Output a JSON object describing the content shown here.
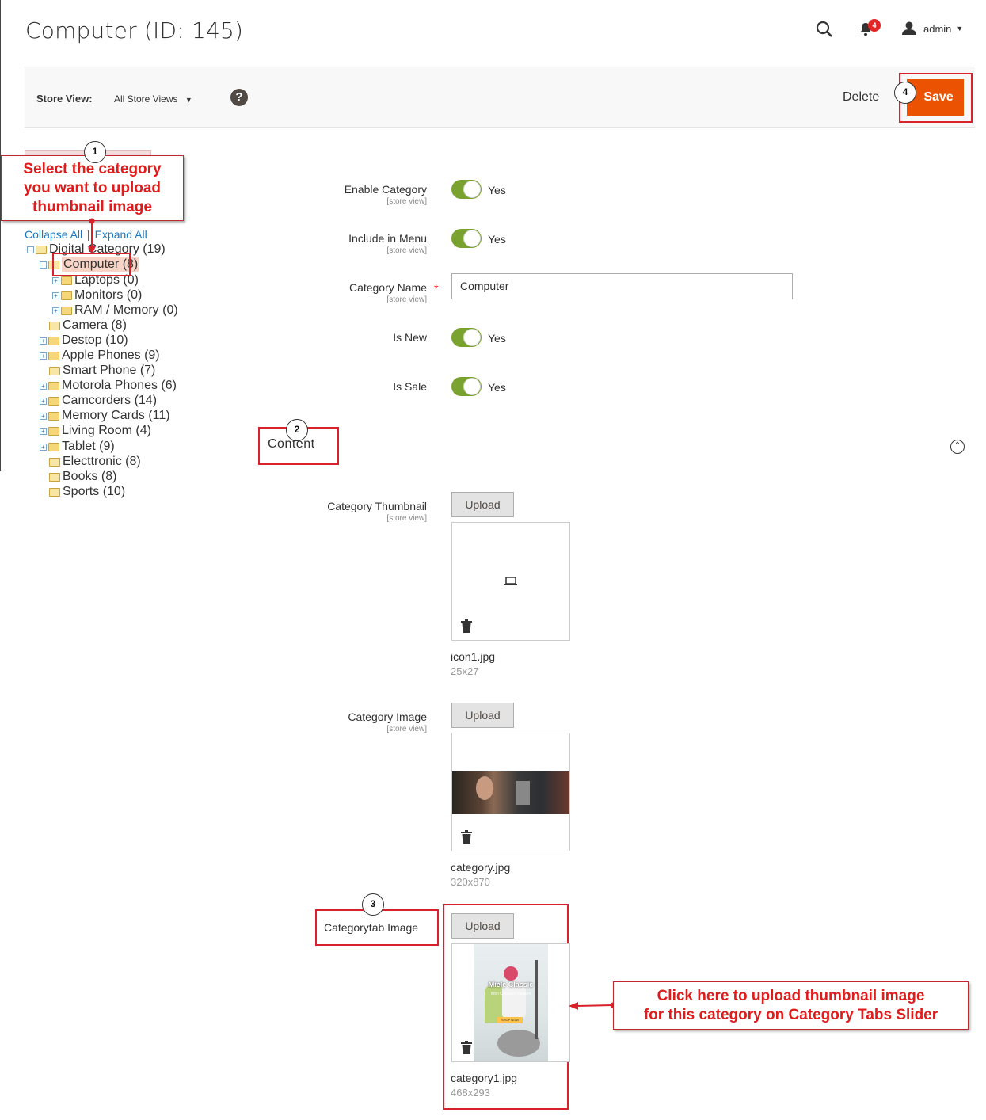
{
  "header": {
    "title": "Computer (ID: 145)",
    "notification_count": "4",
    "user": "admin"
  },
  "toolbar": {
    "store_view_label": "Store View:",
    "store_view_value": "All Store Views",
    "help": "?",
    "delete_label": "Delete",
    "save_label": "Save"
  },
  "annotations": {
    "n1": "1",
    "n2": "2",
    "n3": "3",
    "n4": "4",
    "callout1_lines": [
      "Select the category",
      "you want to upload",
      "thumbnail image"
    ],
    "callout2_lines": [
      "Click here to upload thumbnail image",
      "for this category on Category Tabs Slider"
    ]
  },
  "tree": {
    "collapse_all": "Collapse All",
    "separator": "|",
    "expand_all": "Expand All",
    "nodes": [
      "Digital Category (19)",
      "Computer (8)",
      "Laptops (0)",
      "Monitors (0)",
      "RAM / Memory (0)",
      "Camera (8)",
      "Destop (10)",
      "Apple Phones (9)",
      "Smart Phone (7)",
      "Motorola Phones (6)",
      "Camcorders (14)",
      "Memory Cards (11)",
      "Living Room (4)",
      "Tablet (9)",
      "Electtronic (8)",
      "Books (8)",
      "Sports (10)"
    ]
  },
  "form": {
    "scope": "[store view]",
    "enable_category": {
      "label": "Enable Category",
      "value": "Yes"
    },
    "include_in_menu": {
      "label": "Include in Menu",
      "value": "Yes"
    },
    "category_name": {
      "label": "Category Name",
      "value": "Computer",
      "required": "*"
    },
    "is_new": {
      "label": "Is New",
      "value": "Yes"
    },
    "is_sale": {
      "label": "Is Sale",
      "value": "Yes"
    }
  },
  "content": {
    "section_title": "Content",
    "upload_label": "Upload",
    "thumbnail": {
      "label": "Category Thumbnail",
      "file": "icon1.jpg",
      "size": "25x27"
    },
    "image": {
      "label": "Category Image",
      "file": "category.jpg",
      "size": "320x870"
    },
    "categorytab": {
      "label": "Categorytab Image",
      "file": "category1.jpg",
      "size": "468x293",
      "promo_title": "Miele Classic",
      "promo_sub": "With Compact Vacuum",
      "promo_btn": "SHOP NOW"
    }
  },
  "colors": {
    "accent": "#eb5202",
    "toggle_on": "#79a22e",
    "annotation_red": "#d8212a",
    "link": "#1979c3"
  }
}
